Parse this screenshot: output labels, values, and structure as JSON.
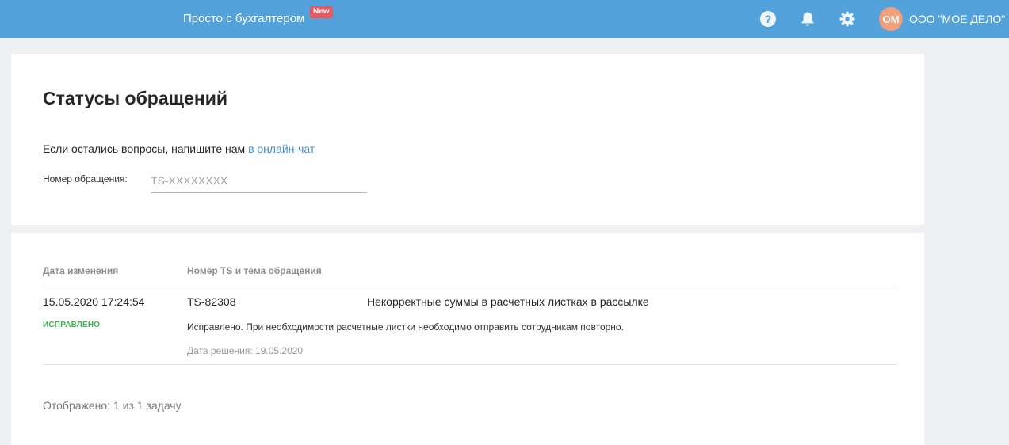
{
  "header": {
    "brand_label": "Просто с бухгалтером",
    "new_badge": "New",
    "avatar_initials": "ОМ",
    "org_name": "ООО \"МОЕ ДЕЛО\"",
    "icons": [
      "help-icon",
      "bell-icon",
      "gear-icon"
    ],
    "bar_color": "#53a2dc"
  },
  "page": {
    "title": "Статусы обращений",
    "chat_note": "Если остались вопросы, напишите нам",
    "chat_link": "в онлайн-чат",
    "ticket_label": "Номер обращения:",
    "ticket_placeholder": "TS-XXXXXXXX",
    "ticket_value": ""
  },
  "table": {
    "headers": {
      "date": "Дата изменения",
      "number": "Номер TS и тема обращения"
    },
    "rows": [
      {
        "date": "15.05.2020 17:24:54",
        "status": "ИСПРАВЛЕНО",
        "ts_number": "TS-82308",
        "subject": "Некорректные суммы в расчетных листках в рассылке",
        "answer": "Исправлено. При необходимости расчетные листки необходимо отправить сотрудникам повторно.",
        "resolved": "Дата решения: 19.05.2020"
      }
    ]
  },
  "footer": {
    "count_text": "Отображено: 1 из 1 задачу"
  },
  "colors": {
    "accent": "#53a2dc",
    "link": "#3d8fd6",
    "status_fixed": "#3fb34f",
    "new_badge": "#e8585c",
    "avatar": "#f0a07a"
  }
}
